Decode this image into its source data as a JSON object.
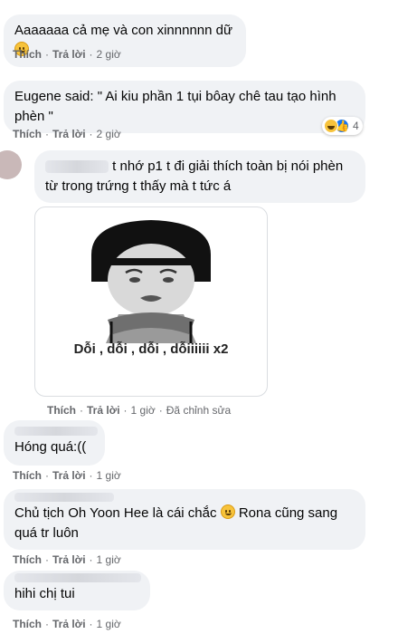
{
  "comments": [
    {
      "text": "Aaaaaaa cả mẹ và con xinnnnnn dữ",
      "like": "Thích",
      "reply": "Trả lời",
      "time": "2 giờ"
    },
    {
      "text": "Eugene said: \" Ai kiu phần 1 tụi bôay chê tau tạo hình phèn \"",
      "like": "Thích",
      "reply": "Trả lời",
      "time": "2 giờ",
      "reaction_count": "4"
    },
    {
      "text": "t nhớ p1 t đi giải thích toàn bị nói phèn từ trong trứng t thấy mà t tức á",
      "sticker_caption": "Dỗi , dỗi , dỗi , dỗiiiiii x2",
      "like": "Thích",
      "reply": "Trả lời",
      "time": "1 giờ",
      "edited": "Đã chỉnh sửa"
    },
    {
      "text": "Hóng quá:((",
      "like": "Thích",
      "reply": "Trả lời",
      "time": "1 giờ"
    },
    {
      "text_a": "Chủ tịch Oh Yoon Hee là cái chắc",
      "text_b": "Rona cũng sang quá tr luôn",
      "like": "Thích",
      "reply": "Trả lời",
      "time": "1 giờ"
    },
    {
      "text": "hihi chị tui",
      "like": "Thích",
      "reply": "Trả lời",
      "time": "1 giờ"
    }
  ],
  "colors": {
    "bubble": "#f0f2f5",
    "meta": "#65676b",
    "like_blue": "#1877f2",
    "haha_yellow": "#f7c33b"
  },
  "icons": [
    "smile-emoji-icon",
    "haha-reaction-icon",
    "like-reaction-icon"
  ]
}
